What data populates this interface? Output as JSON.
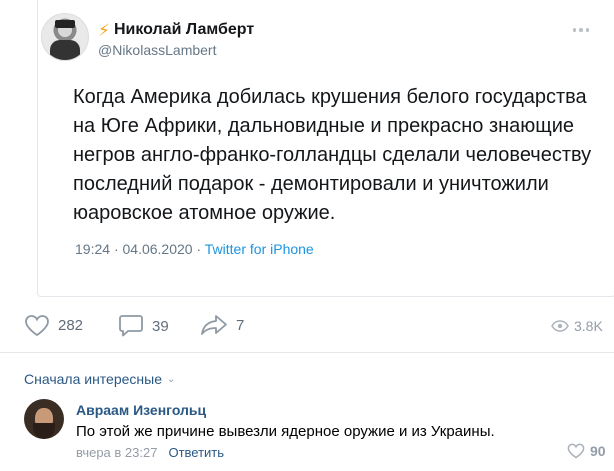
{
  "tweet": {
    "author_name": "Николай Ламберт",
    "author_handle": "@NikolassLambert",
    "text": "Когда Америка добилась крушения белого государства на Юге Африки, дальновидные и прекрасно знающие негров англо-франко-голландцы сделали человечеству последний подарок - демонтировали и уничтожили юаровское атомное оружие.",
    "time": "19:24",
    "date": "04.06.2020",
    "source": "Twitter for iPhone",
    "icons": {
      "verified_like": "lightning-bolt-icon",
      "more": "more-dots-icon"
    }
  },
  "post_stats": {
    "likes": "282",
    "comments": "39",
    "shares": "7",
    "views": "3.8K"
  },
  "comments_section": {
    "sort_label": "Сначала интересные",
    "comments": [
      {
        "author": "Авраам Изенгольц",
        "text": "По этой же причине вывезли ядерное оружие и из Украины.",
        "time": "вчера в 23:27",
        "reply_label": "Ответить",
        "likes": "90"
      }
    ]
  },
  "colors": {
    "link": "#2a5885",
    "twitter_blue": "#1b95e0",
    "muted": "#939ca7",
    "bolt": "#f5a623"
  }
}
